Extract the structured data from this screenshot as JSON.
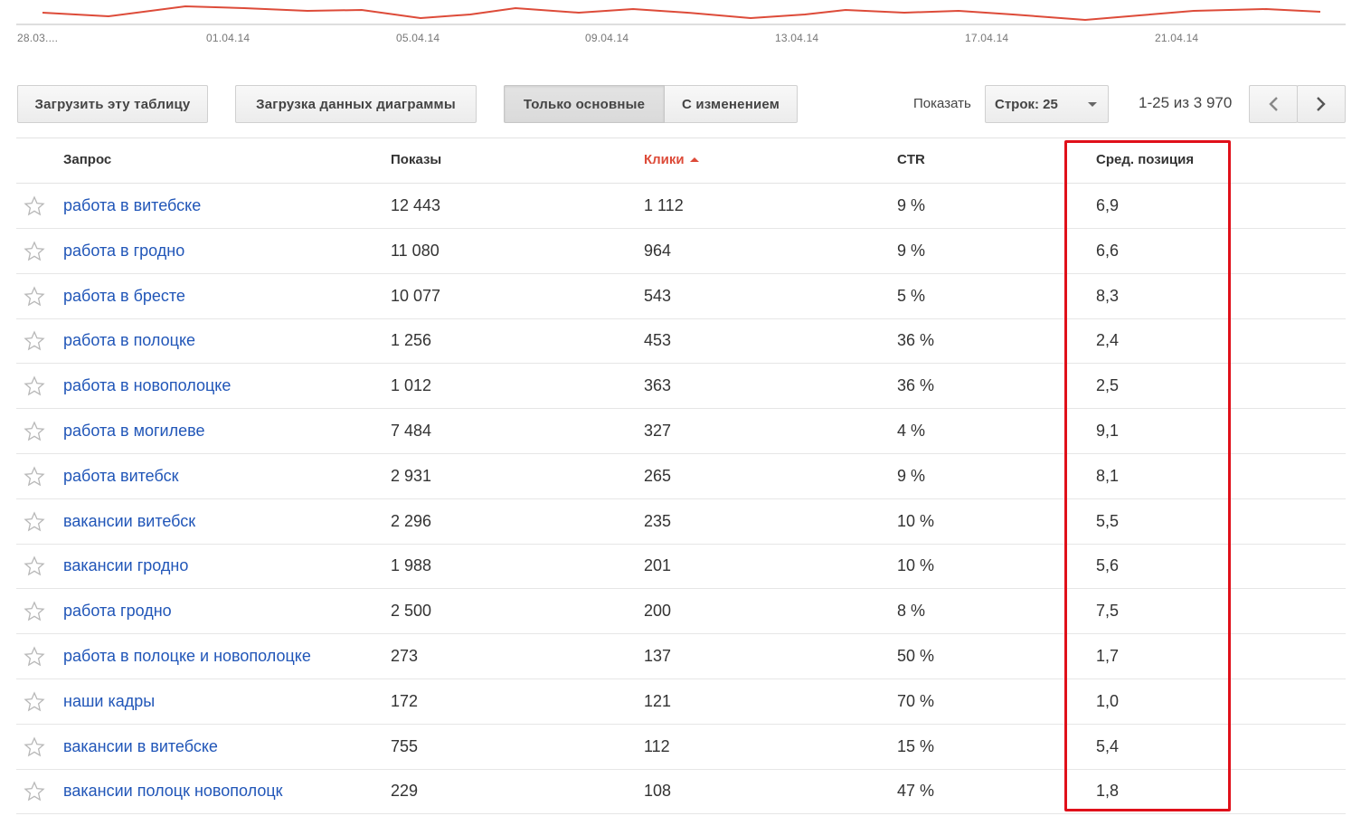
{
  "chart": {
    "x_labels": [
      "28.03....",
      "01.04.14",
      "05.04.14",
      "09.04.14",
      "13.04.14",
      "17.04.14",
      "21.04.14"
    ],
    "line_color": "#dd4b39"
  },
  "toolbar": {
    "download_table": "Загрузить эту таблицу",
    "download_chart": "Загрузка данных диаграммы",
    "only_main": "Только основные",
    "with_change": "С изменением",
    "show_label": "Показать",
    "rows_select": "Строк: 25",
    "pager_range": "1-25 из 3 970"
  },
  "icons": {
    "prev": "chevron-left-icon",
    "next": "chevron-right-icon",
    "star": "star-outline-icon",
    "caret": "caret-down-icon",
    "sort": "sort-ascending-icon"
  },
  "table": {
    "headers": {
      "query": "Запрос",
      "shows": "Показы",
      "clicks": "Клики",
      "ctr": "CTR",
      "position": "Сред. позиция"
    },
    "rows": [
      {
        "query": "работа в витебске",
        "shows": "12 443",
        "clicks": "1 112",
        "ctr": "9 %",
        "position": "6,9"
      },
      {
        "query": "работа в гродно",
        "shows": "11 080",
        "clicks": "964",
        "ctr": "9 %",
        "position": "6,6"
      },
      {
        "query": "работа в бресте",
        "shows": "10 077",
        "clicks": "543",
        "ctr": "5 %",
        "position": "8,3"
      },
      {
        "query": "работа в полоцке",
        "shows": "1 256",
        "clicks": "453",
        "ctr": "36 %",
        "position": "2,4"
      },
      {
        "query": "работа в новополоцке",
        "shows": "1 012",
        "clicks": "363",
        "ctr": "36 %",
        "position": "2,5"
      },
      {
        "query": "работа в могилеве",
        "shows": "7 484",
        "clicks": "327",
        "ctr": "4 %",
        "position": "9,1"
      },
      {
        "query": "работа витебск",
        "shows": "2 931",
        "clicks": "265",
        "ctr": "9 %",
        "position": "8,1"
      },
      {
        "query": "вакансии витебск",
        "shows": "2 296",
        "clicks": "235",
        "ctr": "10 %",
        "position": "5,5"
      },
      {
        "query": "вакансии гродно",
        "shows": "1 988",
        "clicks": "201",
        "ctr": "10 %",
        "position": "5,6"
      },
      {
        "query": "работа гродно",
        "shows": "2 500",
        "clicks": "200",
        "ctr": "8 %",
        "position": "7,5"
      },
      {
        "query": "работа в полоцке и новополоцке",
        "shows": "273",
        "clicks": "137",
        "ctr": "50 %",
        "position": "1,7"
      },
      {
        "query": "наши кадры",
        "shows": "172",
        "clicks": "121",
        "ctr": "70 %",
        "position": "1,0"
      },
      {
        "query": "вакансии в витебске",
        "shows": "755",
        "clicks": "112",
        "ctr": "15 %",
        "position": "5,4"
      },
      {
        "query": "вакансии полоцк новополоцк",
        "shows": "229",
        "clicks": "108",
        "ctr": "47 %",
        "position": "1,8"
      }
    ]
  },
  "highlight_color": "#e0101a"
}
